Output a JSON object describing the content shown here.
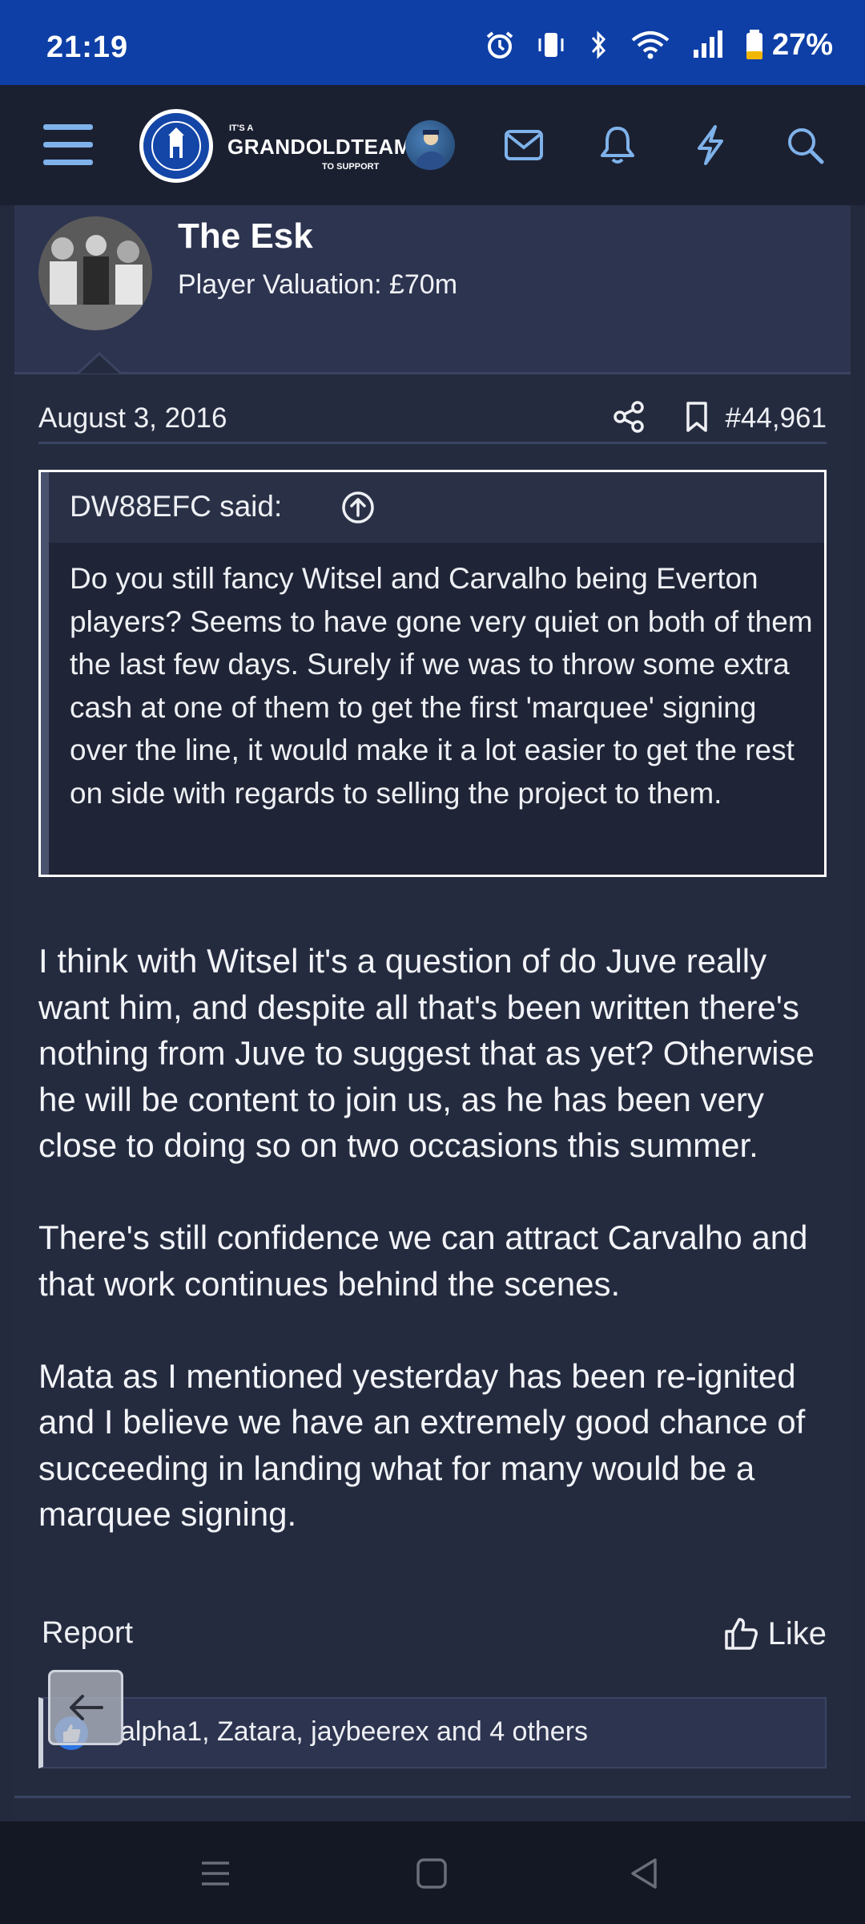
{
  "status_bar": {
    "time": "21:19",
    "battery_percent": "27%",
    "icons": [
      "alarm-icon",
      "vibrate-icon",
      "bluetooth-icon",
      "wifi-icon",
      "signal-icon",
      "battery-icon"
    ]
  },
  "nav": {
    "logo_small": "IT'S A",
    "logo_main": "GRANDOLDTEAM",
    "logo_sub": "TO SUPPORT",
    "icons": [
      "menu-icon",
      "user-avatar",
      "mail-icon",
      "bell-icon",
      "bolt-icon",
      "search-icon"
    ]
  },
  "post": {
    "author_name": "The Esk",
    "author_title": "Player Valuation: £70m",
    "date": "August 3, 2016",
    "post_number": "#44,961",
    "quote": {
      "author": "DW88EFC said:",
      "text": "Do you still fancy Witsel and Carvalho being Everton players? Seems to have gone very quiet on both of them the last few days. Surely if we was to throw some extra cash at one of them to get the first 'marquee' signing over the line, it would make it a lot easier to get the rest on side with regards to selling the project to them."
    },
    "paragraphs": [
      "I think with Witsel it's a question of do Juve really want him, and despite all that's been written there's nothing from Juve to suggest that as yet? Otherwise he will be content to join us, as he has been very close to doing so on two occasions this summer.",
      "There's still confidence we can attract Carvalho and that work continues behind the scenes.",
      "Mata as I mentioned yesterday has been re-ignited and I believe we have an extremely good chance of succeeding in landing what for many would be a marquee signing."
    ],
    "report_label": "Report",
    "like_label": "Like",
    "reactions_text": "alpha1, Zatara, jaybeerex and 4 others"
  },
  "colors": {
    "status_bar": "#0e3fa6",
    "nav_bg": "#1b2031",
    "page_bg": "#242a3d",
    "accent": "#7fb2ea"
  }
}
